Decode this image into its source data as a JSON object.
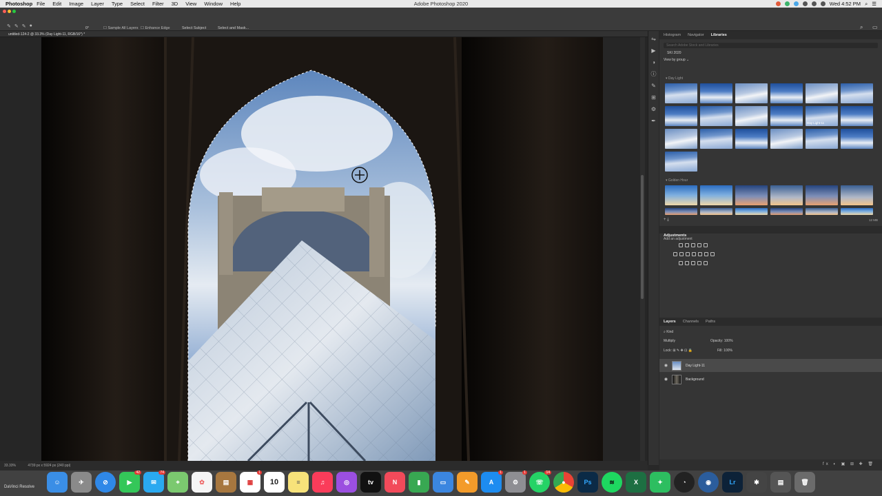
{
  "menubar": {
    "app_name": "Photoshop",
    "menus": [
      "File",
      "Edit",
      "Image",
      "Layer",
      "Type",
      "Select",
      "Filter",
      "3D",
      "View",
      "Window",
      "Help"
    ],
    "window_title": "Adobe Photoshop 2020",
    "clock": "Wed 4:52 PM"
  },
  "options_bar": {
    "angle": "0°",
    "sample_all_layers": "Sample All Layers",
    "enhance_edge": "Enhance Edge",
    "select_subject": "Select Subject",
    "select_and_mask": "Select and Mask..."
  },
  "document": {
    "tab_title": "untitled-124-2 @ 33.3% (Day Light-11, RGB/16*) *",
    "zoom": "33.33%",
    "doc_size": "4739 px x 5924 px (240 ppi)"
  },
  "panels": {
    "top_tabs": [
      "Histogram",
      "Navigator",
      "Libraries"
    ],
    "active_top_tab": "Libraries",
    "library_search_placeholder": "Search Adobe Stock and Libraries",
    "library_name": "SKI 2020",
    "view_by": "View by group",
    "groups": [
      {
        "name": "Day Light",
        "thumbs": 19,
        "hover_label": "Day Light-11"
      },
      {
        "name": "Golden Hour",
        "thumbs": 12
      }
    ],
    "library_size": "12 MB",
    "adjustments": {
      "title": "Adjustments",
      "hint": "Add an adjustment"
    },
    "layers_tabs": [
      "Layers",
      "Channels",
      "Paths"
    ],
    "filter_kind": "Kind",
    "blend_mode": "Multiply",
    "opacity_label": "Opacity:",
    "opacity": "100%",
    "lock_label": "Lock:",
    "fill_label": "Fill:",
    "fill": "100%",
    "layers": [
      {
        "name": "Day Light-11",
        "selected": true
      },
      {
        "name": "Background",
        "selected": false
      }
    ]
  },
  "dock": {
    "left_label": "DaVinci Resolve",
    "calendar_day": "10",
    "photoshop_label": "Ps",
    "lightroom_label": "Lr",
    "excel_label": "X",
    "badges": {
      "facetime": "42",
      "messages": "74",
      "spotify": "",
      "calendar": "1",
      "appstore": "1",
      "sysprefs": "1",
      "whatsapp": "14"
    },
    "icons": [
      "finder",
      "launchpad",
      "safari",
      "facetime",
      "messages",
      "maps",
      "photos",
      "notes-brown",
      "calendar",
      "notes",
      "music",
      "podcasts",
      "tv",
      "news",
      "numbers",
      "keynote",
      "pages",
      "app-store",
      "system-preferences",
      "whatsapp",
      "chrome",
      "photoshop",
      "spotify",
      "excel",
      "evernote",
      "davinci-resolve",
      "lightroom",
      "bridge",
      "settings-round",
      "photo-stack",
      "trash"
    ]
  }
}
